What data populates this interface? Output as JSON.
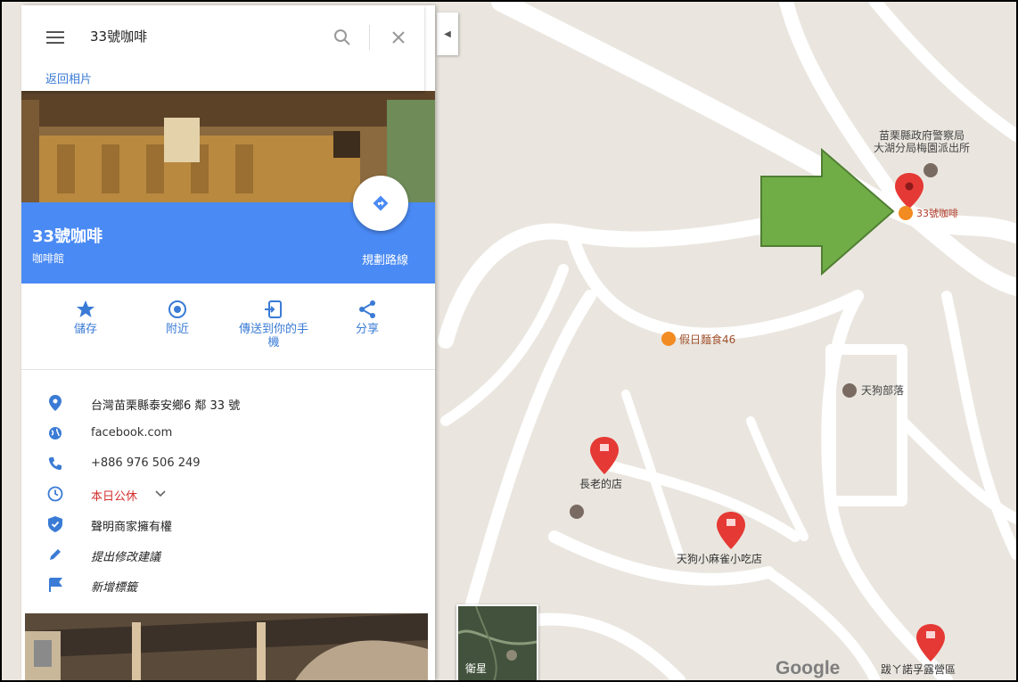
{
  "search": {
    "query": "33號咖啡",
    "back_link": "返回相片"
  },
  "place": {
    "name": "33號咖啡",
    "category": "咖啡館",
    "route_label": "規劃路線"
  },
  "actions": [
    {
      "label": "儲存",
      "icon": "star-icon"
    },
    {
      "label": "附近",
      "icon": "nearby-icon"
    },
    {
      "label": "傳送到你的手\n機",
      "icon": "send-to-phone-icon"
    },
    {
      "label": "分享",
      "icon": "share-icon"
    }
  ],
  "info": {
    "address": "台灣苗栗縣泰安鄉6 鄰 33 號",
    "website": "facebook.com",
    "phone": "+886 976 506 249",
    "hours": "本日公休",
    "claimed": "聲明商家擁有權",
    "suggest_edit": "提出修改建議",
    "add_label": "新增標籤"
  },
  "map": {
    "labels": {
      "police": "苗栗縣政府警察局\n大湖分局梅園派出所",
      "cafe": "33號咖啡",
      "noodle": "假日麵食46",
      "tengu_village": "天狗部落",
      "elder_shop": "長老的店",
      "tengu_snack": "天狗小麻雀小吃店",
      "camp": "跋ㄚ諾孚露營區"
    },
    "satellite_label": "衛星",
    "logo": "Google"
  },
  "colors": {
    "accent": "#4a8af4",
    "link": "#3a7bd5",
    "pin": "#e53935",
    "arrow": "#70ad47"
  }
}
